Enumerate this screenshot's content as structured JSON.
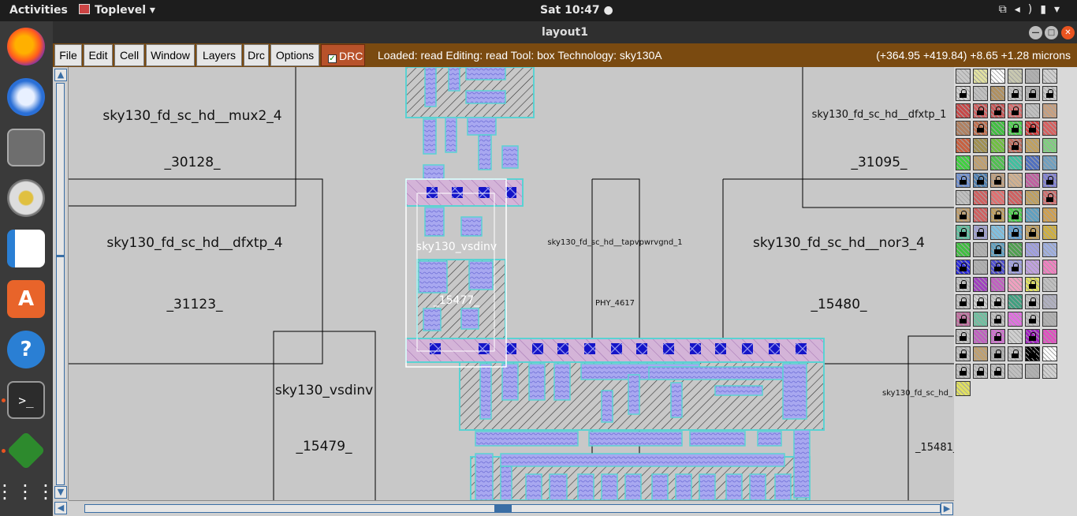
{
  "topbar": {
    "activities": "Activities",
    "app_name": "Toplevel",
    "app_menu_arrow": "▾",
    "clock": "Sat 10:47",
    "tray_icons": [
      "network-icon",
      "volume-icon",
      "battery-icon",
      "power-menu-icon"
    ]
  },
  "dock": {
    "items": [
      "firefox-icon",
      "thunderbird-icon",
      "files-icon",
      "rhythmbox-icon",
      "writer-icon",
      "software-icon",
      "help-icon",
      "terminal-icon",
      "vim-icon",
      "app-grid-icon"
    ]
  },
  "window": {
    "title": "layout1"
  },
  "menubar": {
    "file": "File",
    "edit": "Edit",
    "cell": "Cell",
    "window": "Window",
    "layers": "Layers",
    "drc": "Drc",
    "options": "Options",
    "drc_toggle": "DRC",
    "drc_checked": true,
    "status": "Loaded: read Editing: read Tool: box  Technology: sky130A",
    "coords": "(+364.95 +419.84) +8.65 +1.28 microns"
  },
  "canvas": {
    "cells": [
      {
        "name": "sky130_fd_sc_hd__mux2_4",
        "id": "_30128_"
      },
      {
        "name": "sky130_fd_sc_hd__dfxtp_4",
        "id": "_31123_"
      },
      {
        "name": "sky130_vsdinv",
        "id": "_15479_"
      },
      {
        "name": "sky130_vsdinv",
        "id": "_15477_"
      },
      {
        "name": "sky130_fd_sc_hd__tapvpwrvgnd_1",
        "id": "PHY_4617"
      },
      {
        "name": "sky130_fd_sc_hd__dfxtp_1",
        "id": "_31095_"
      },
      {
        "name": "sky130_fd_sc_hd__nor3_4",
        "id": "_15480_"
      },
      {
        "name": "sky130_fd_sc_hd_",
        "id": "_15481_"
      }
    ]
  },
  "colors": {
    "menubar_bg": "#7a4a10",
    "canvas_bg": "#c8c8c8",
    "metal1": "#a8a8f0",
    "contact": "#1414c8",
    "poly_hatch": "#333333",
    "diffusion": "#5ad2d2"
  }
}
